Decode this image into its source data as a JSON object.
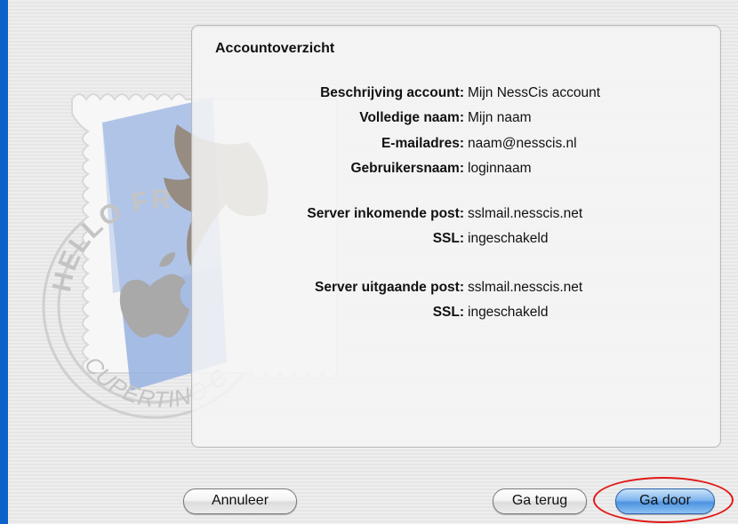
{
  "panel": {
    "title": "Accountoverzicht",
    "account": [
      {
        "label": "Beschrijving account:",
        "value": "Mijn NessCis account"
      },
      {
        "label": "Volledige naam:",
        "value": "Mijn naam"
      },
      {
        "label": "E-mailadres:",
        "value": "naam@nesscis.nl"
      },
      {
        "label": "Gebruikersnaam:",
        "value": "loginnaam"
      }
    ],
    "incoming": [
      {
        "label": "Server inkomende post:",
        "value": "sslmail.nesscis.net"
      },
      {
        "label": "SSL:",
        "value": "ingeschakeld"
      }
    ],
    "outgoing": [
      {
        "label": "Server uitgaande post:",
        "value": "sslmail.nesscis.net"
      },
      {
        "label": "SSL:",
        "value": "ingeschakeld"
      }
    ]
  },
  "stamp": {
    "arc_text_top": "HELLO FR",
    "arc_text_bottom": "CUPERTINO CA"
  },
  "buttons": {
    "cancel": "Annuleer",
    "back": "Ga terug",
    "continue": "Ga door"
  },
  "colors": {
    "desktop": "#0b63c9",
    "highlight": "#e01818",
    "primary_button": "#4d93e0"
  }
}
